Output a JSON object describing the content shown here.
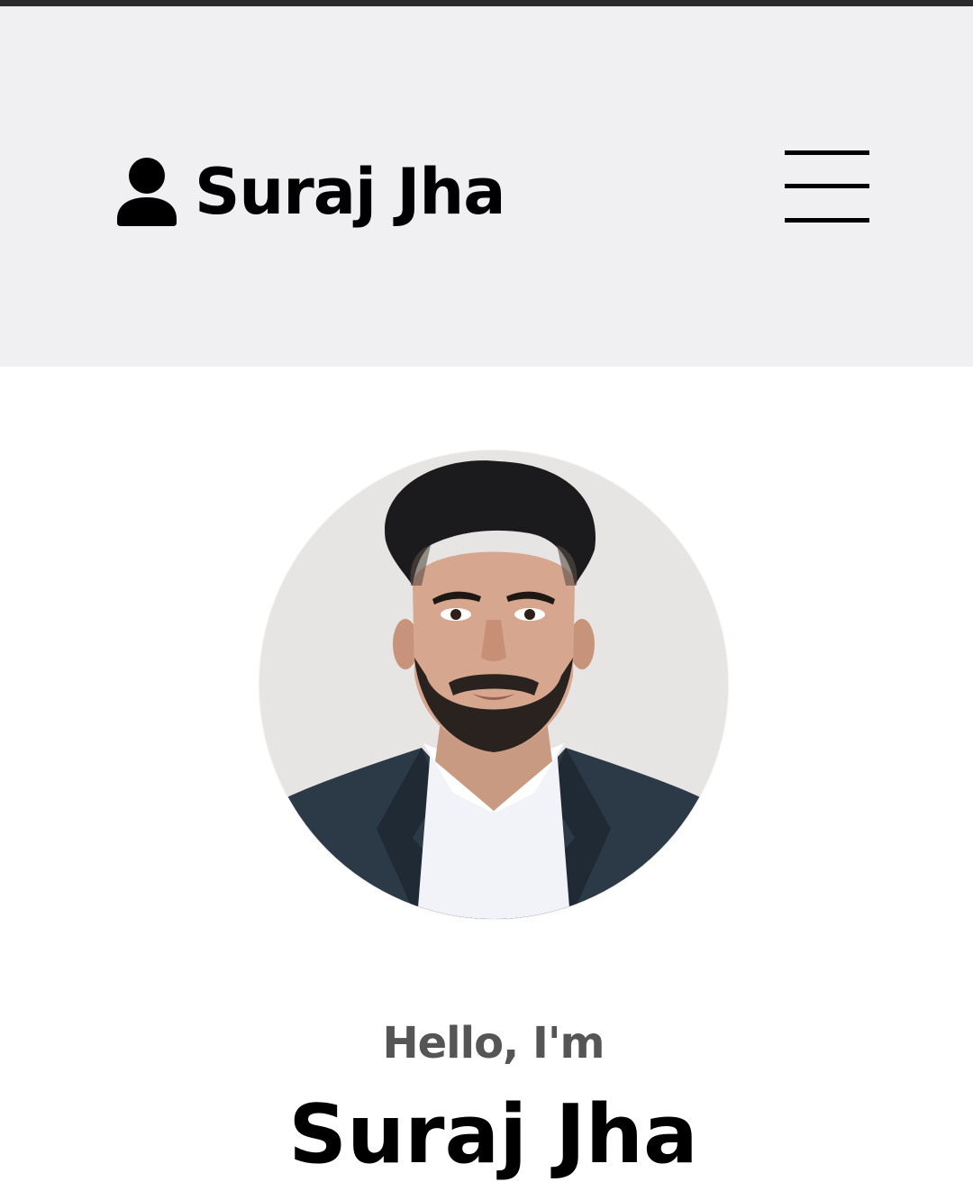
{
  "header": {
    "brand_name": "Suraj Jha",
    "brand_icon": "user-icon",
    "menu_icon": "hamburger-menu-icon"
  },
  "hero": {
    "greeting": "Hello, I'm",
    "name": "Suraj Jha",
    "photo": "profile-photo"
  },
  "colors": {
    "header_bg": "#f0eff2",
    "text": "#000000",
    "greeting_text": "#555555"
  }
}
